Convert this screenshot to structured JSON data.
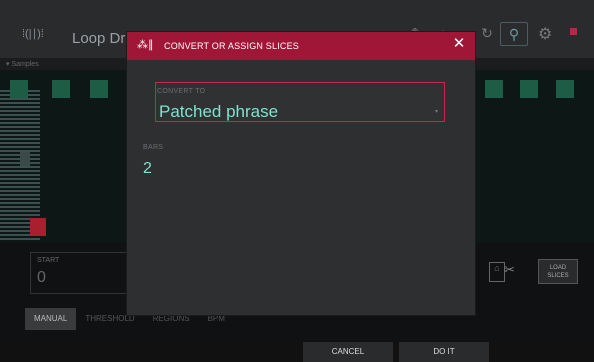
{
  "background_app": {
    "title": "Loop Dru",
    "ruler_labels": [
      "▾ Samples"
    ],
    "start_label": "START",
    "start_value": "0",
    "load_slices_label": "LOAD SLICES",
    "tabs": [
      {
        "label": "MANUAL",
        "active": true
      },
      {
        "label": "THRESHOLD",
        "active": false
      },
      {
        "label": "REGIONS",
        "active": false
      },
      {
        "label": "BPM",
        "active": false
      }
    ]
  },
  "dialog": {
    "title": "CONVERT OR ASSIGN SLICES",
    "convert_to_label": "CONVERT TO",
    "convert_to_value": "Patched phrase",
    "bars_label": "BARS",
    "bars_value": "2",
    "accent_color": "#a01636",
    "value_color": "#7fe3cf"
  },
  "footer": {
    "cancel_label": "CANCEL",
    "do_it_label": "DO IT"
  },
  "icons": [
    "app-icon",
    "slice-icon",
    "close-icon",
    "zoom-icon",
    "gear-icon",
    "stop-icon"
  ]
}
